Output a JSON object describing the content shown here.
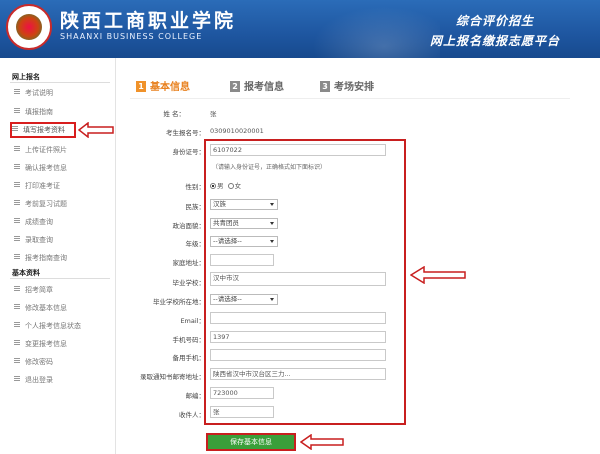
{
  "header": {
    "school_cn": "陕西工商职业学院",
    "school_en": "SHAANXI BUSINESS COLLEGE",
    "slogan_line1": "综合评价招生",
    "slogan_line2": "网上报名缴报志愿平台"
  },
  "sidebar": {
    "section1": "网上报名",
    "items1": [
      "考试说明",
      "填报指南",
      "填写报考资料",
      "上传证件照片",
      "确认报考信息",
      "打印准考证",
      "考前复习试题",
      "成绩查询",
      "录取查询",
      "报考指南查询"
    ],
    "section2": "基本资料",
    "items2": [
      "招考简章",
      "修改基本信息",
      "个人报考信息状态",
      "变更报考信息",
      "修改密码",
      "退出登录"
    ]
  },
  "steps": [
    {
      "num": "1",
      "label": "基本信息"
    },
    {
      "num": "2",
      "label": "报考信息"
    },
    {
      "num": "3",
      "label": "考场安排"
    }
  ],
  "form": {
    "name_label": "姓  名：",
    "name_value": "张",
    "exam_no_label": "考生报名号：",
    "exam_no_value": "0309010020001",
    "id_label": "身份证号：",
    "id_value": "6107022",
    "id_hint": "（请输入身份证号，正确格式如下面标识）",
    "gender_label": "性别：",
    "gender_male": "男",
    "gender_female": "女",
    "nation_label": "民族：",
    "nation_value": "汉族",
    "politics_label": "政治面貌：",
    "politics_value": "共青团员",
    "grade_label": "年级：",
    "grade_value": "--请选择--",
    "address_label": "家庭地址：",
    "school_label": "毕业学校：",
    "school_value": "汉中市汉",
    "school_loc_label": "毕业学校所在地：",
    "school_loc_value": "--请选择--",
    "email_label": "Email：",
    "mobile_label": "手机号码：",
    "mobile_value": "1397",
    "backup_label": "备用手机：",
    "mail_addr_label": "录取通知书邮寄地址：",
    "mail_addr_value": "陕西省汉中市汉台区三力...",
    "zip_label": "邮编：",
    "zip_value": "723000",
    "receiver_label": "收件人：",
    "receiver_value": "张"
  },
  "save_button": "保存基本信息"
}
